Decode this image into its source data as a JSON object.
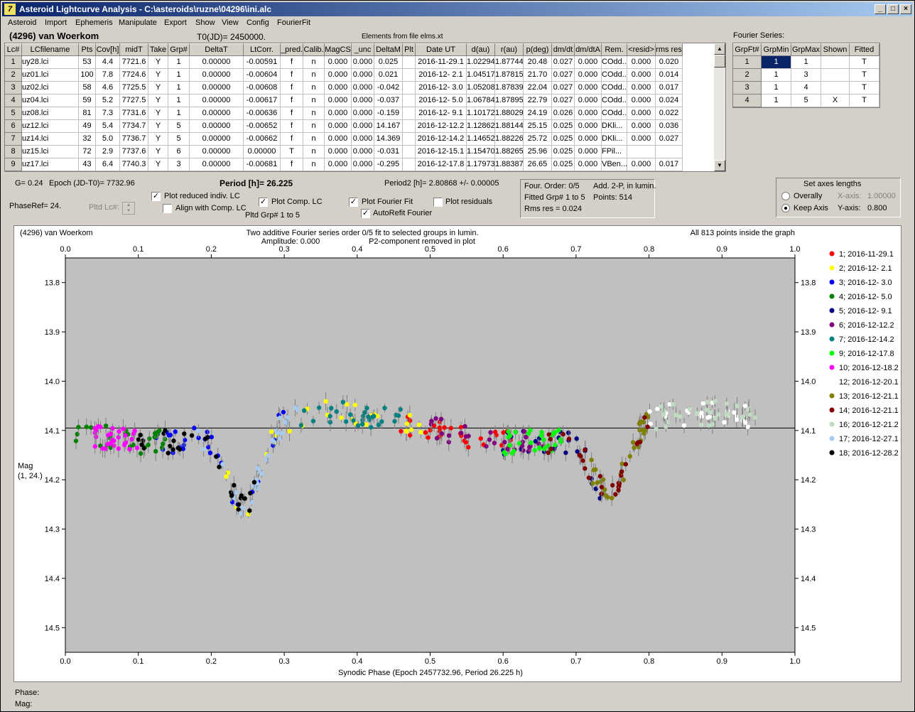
{
  "window": {
    "title": "Asteroid Lightcurve Analysis - C:\\asteroids\\ruzne\\04296\\ini.alc",
    "icon": "lightcurve-app-icon"
  },
  "menu": [
    "Asteroid",
    "Import",
    "Ephemeris",
    "Manipulate",
    "Export",
    "Show",
    "View",
    "Config",
    "FourierFit"
  ],
  "header": {
    "asteroid": "(4296) van Woerkom",
    "t0": "T0(JD)= 2450000.",
    "elements": "Elements from file elms.xt",
    "fourier_series": "Fourier Series:"
  },
  "lc_table": {
    "columns": [
      "Lc#",
      "LCfilename",
      "Pts",
      "Cov[h]",
      "midT",
      "Take",
      "Grp#",
      "DeltaT",
      "LtCorr.",
      "_pred.",
      "Calib.",
      "MagCS",
      "_unc",
      "DeltaM",
      "Plt",
      "Date UT",
      "d(au)",
      "r(au)",
      "p(deg)",
      "dm/dt",
      "dm/dtA",
      "Rem.",
      "<resid>",
      "rms res"
    ],
    "rows": [
      [
        "1",
        "uy28.lci",
        "53",
        "4.4",
        "7721.6",
        "Y",
        "1",
        "0.00000",
        "-0.00591",
        "f",
        "n",
        "0.000",
        "0.000",
        "0.025",
        "",
        "2016-11-29.1",
        "1.02294",
        "1.87744",
        "20.48",
        "0.027",
        "0.000",
        "COdd...",
        "0.000",
        "0.020"
      ],
      [
        "2",
        "uz01.lci",
        "100",
        "7.8",
        "7724.6",
        "Y",
        "1",
        "0.00000",
        "-0.00604",
        "f",
        "n",
        "0.000",
        "0.000",
        "0.021",
        "",
        "2016-12- 2.1",
        "1.04517",
        "1.87815",
        "21.70",
        "0.027",
        "0.000",
        "COdd...",
        "0.000",
        "0.014"
      ],
      [
        "3",
        "uz02.lci",
        "58",
        "4.6",
        "7725.5",
        "Y",
        "1",
        "0.00000",
        "-0.00608",
        "f",
        "n",
        "0.000",
        "0.000",
        "-0.042",
        "",
        "2016-12- 3.0",
        "1.05208",
        "1.87839",
        "22.04",
        "0.027",
        "0.000",
        "COdd...",
        "0.000",
        "0.017"
      ],
      [
        "4",
        "uz04.lci",
        "59",
        "5.2",
        "7727.5",
        "Y",
        "1",
        "0.00000",
        "-0.00617",
        "f",
        "n",
        "0.000",
        "0.000",
        "-0.037",
        "",
        "2016-12- 5.0",
        "1.06784",
        "1.87895",
        "22.79",
        "0.027",
        "0.000",
        "COdd...",
        "0.000",
        "0.024"
      ],
      [
        "5",
        "uz08.lci",
        "81",
        "7.3",
        "7731.6",
        "Y",
        "1",
        "0.00000",
        "-0.00636",
        "f",
        "n",
        "0.000",
        "0.000",
        "-0.159",
        "",
        "2016-12- 9.1",
        "1.10172",
        "1.88029",
        "24.19",
        "0.026",
        "0.000",
        "COdd...",
        "0.000",
        "0.022"
      ],
      [
        "6",
        "uz12.lci",
        "49",
        "5.4",
        "7734.7",
        "Y",
        "5",
        "0.00000",
        "-0.00652",
        "f",
        "n",
        "0.000",
        "0.000",
        "14.167",
        "",
        "2016-12-12.2",
        "1.12862",
        "1.88144",
        "25.15",
        "0.025",
        "0.000",
        "DKli...",
        "0.000",
        "0.036"
      ],
      [
        "7",
        "uz14.lci",
        "32",
        "5.0",
        "7736.7",
        "Y",
        "5",
        "0.00000",
        "-0.00662",
        "f",
        "n",
        "0.000",
        "0.000",
        "14.369",
        "",
        "2016-12-14.2",
        "1.14652",
        "1.88226",
        "25.72",
        "0.025",
        "0.000",
        "DKli...",
        "0.000",
        "0.027"
      ],
      [
        "8",
        "uz15.lci",
        "72",
        "2.9",
        "7737.6",
        "Y",
        "6",
        "0.00000",
        "0.00000",
        "T",
        "n",
        "0.000",
        "0.000",
        "-0.031",
        "",
        "2016-12-15.1",
        "1.15470",
        "1.88265",
        "25.96",
        "0.025",
        "0.000",
        "FPil...",
        "",
        ""
      ],
      [
        "9",
        "uz17.lci",
        "43",
        "6.4",
        "7740.3",
        "Y",
        "3",
        "0.00000",
        "-0.00681",
        "f",
        "n",
        "0.000",
        "0.000",
        "-0.295",
        "",
        "2016-12-17.8",
        "1.17973",
        "1.88387",
        "26.65",
        "0.025",
        "0.000",
        "VBen...",
        "0.000",
        "0.017"
      ]
    ]
  },
  "fourier_table": {
    "columns": [
      "GrpFt#",
      "GrpMin",
      "GrpMax",
      "Shown",
      "Fitted"
    ],
    "rows": [
      [
        "1",
        "1",
        "1",
        "",
        "T"
      ],
      [
        "2",
        "1",
        "3",
        "",
        "T"
      ],
      [
        "3",
        "1",
        "4",
        "",
        "T"
      ],
      [
        "4",
        "1",
        "5",
        "X",
        "T"
      ]
    ]
  },
  "controls": {
    "g": "G= 0.24",
    "epoch": "Epoch (JD-T0)= 7732.96",
    "period": "Period [h]= 26.225",
    "period2": "Period2 [h]= 2.80868 +/- 0.00005",
    "phaseref": "PhaseRef= 24.",
    "pltd_lc": "Pltd Lc#:",
    "plot_reduced": "Plot reduced indiv. LC",
    "align": "Align with Comp. LC",
    "plot_comp": "Plot Comp. LC",
    "pltd_grp": "Pltd Grp#  1   to   5",
    "plot_fourier": "Plot Fourier Fit",
    "autorefit": "AutoRefit Fourier",
    "plot_resid": "Plot residuals",
    "checks": {
      "plot_reduced": true,
      "align": false,
      "plot_comp": true,
      "plot_fourier": true,
      "autorefit": true,
      "plot_resid": false
    }
  },
  "fit_info": {
    "order": "Four. Order:  0/5",
    "add": "Add. 2-P, in lumin.",
    "fitted": "Fitted Grp# 1 to 5",
    "points": "Points: 514",
    "rms": "Rms res      = 0.024"
  },
  "axes_panel": {
    "title": "Set axes lengths",
    "overally": "Overally",
    "keep": "Keep Axis",
    "xaxis": "X-axis:",
    "xval": "1.00000",
    "yaxis": "Y-axis:",
    "yval": "0.800"
  },
  "plot": {
    "name": "(4296) van Woerkom",
    "subtitle1": "Two additive Fourier series order 0/5 fit to selected groups in lumin.",
    "subtitle2": "Amplitude: 0.000",
    "subtitle3": "P2-component removed in plot",
    "inside": "All 813 points inside the graph",
    "ylabel1": "Mag",
    "ylabel2": "(1, 24.)",
    "xlabel": "Synodic Phase (Epoch 2457732.96, Period 26.225 h)"
  },
  "status": {
    "phase": "Phase:",
    "mag": "Mag:"
  },
  "chart_data": {
    "type": "scatter",
    "xlim": [
      0,
      1
    ],
    "ylim": [
      14.55,
      13.75
    ],
    "xticks": [
      "0.0",
      "0.1",
      "0.2",
      "0.3",
      "0.4",
      "0.5",
      "0.6",
      "0.7",
      "0.8",
      "0.9",
      "1.0"
    ],
    "yticks": [
      "13.8",
      "13.9",
      "14.0",
      "14.1",
      "14.2",
      "14.3",
      "14.4",
      "14.5"
    ],
    "mean_line": 14.095,
    "legend_placement": "right",
    "series": [
      {
        "name": "1; 2016-11-29.1",
        "color": "#ff0000",
        "range": [
          0.46,
          0.62
        ]
      },
      {
        "name": "2; 2016-12- 2.1",
        "color": "#ffff00",
        "range": [
          0.22,
          0.5
        ]
      },
      {
        "name": "3; 2016-12- 3.0",
        "color": "#0000ff",
        "range": [
          0.12,
          0.3
        ]
      },
      {
        "name": "4; 2016-12- 5.0",
        "color": "#008000",
        "range": [
          0.0,
          0.14
        ]
      },
      {
        "name": "5; 2016-12- 9.1",
        "color": "#000080",
        "range": [
          0.6,
          0.74
        ]
      },
      {
        "name": "6; 2016-12-12.2",
        "color": "#800080",
        "range": [
          0.48,
          0.66
        ]
      },
      {
        "name": "7; 2016-12-14.2",
        "color": "#008080",
        "range": [
          0.32,
          0.46
        ]
      },
      {
        "name": "9; 2016-12-17.8",
        "color": "#00ff00",
        "range": [
          0.6,
          0.68
        ]
      },
      {
        "name": "10; 2016-12-18.2",
        "color": "#ff00ff",
        "range": [
          0.04,
          0.1
        ]
      },
      {
        "name": "12; 2016-12-20.1",
        "color": "#ffffff",
        "range": [
          0.8,
          0.94
        ]
      },
      {
        "name": "13; 2016-12-21.1",
        "color": "#808000",
        "range": [
          0.72,
          0.8
        ]
      },
      {
        "name": "14; 2016-12-21.1",
        "color": "#800000",
        "range": [
          0.66,
          0.8
        ]
      },
      {
        "name": "16; 2016-12-21.2",
        "color": "#c0dcc0",
        "range": [
          0.8,
          0.96
        ]
      },
      {
        "name": "17; 2016-12-27.1",
        "color": "#a6caf0",
        "range": [
          0.18,
          0.32
        ]
      },
      {
        "name": "18; 2016-12-28.2",
        "color": "#000000",
        "range": [
          0.1,
          0.26
        ]
      }
    ]
  }
}
